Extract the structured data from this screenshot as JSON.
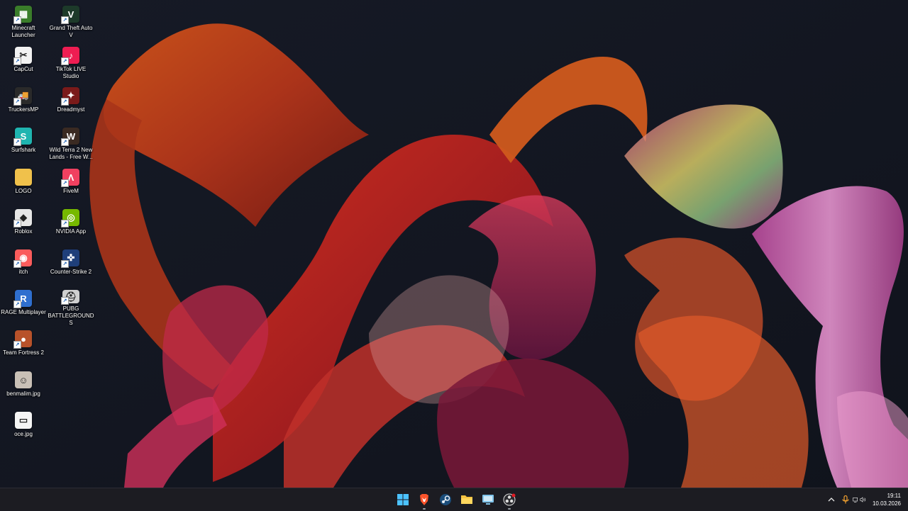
{
  "desktop": {
    "icons": [
      {
        "label": "Minecraft Launcher",
        "icon": "minecraft-icon",
        "color": "#3a7d2a",
        "glyph": "▦"
      },
      {
        "label": "CapCut",
        "icon": "capcut-icon",
        "color": "#f2f2f2",
        "glyph": "✂"
      },
      {
        "label": "TruckersMP",
        "icon": "truckersmp-icon",
        "color": "#2a2a2a",
        "glyph": "🚚"
      },
      {
        "label": "Surfshark",
        "icon": "surfshark-icon",
        "color": "#1fb5b0",
        "glyph": "S"
      },
      {
        "label": "LOGO",
        "icon": "folder-icon",
        "color": "#f0c14b",
        "glyph": ""
      },
      {
        "label": "Roblox",
        "icon": "roblox-icon",
        "color": "#e6e6e6",
        "glyph": "◆"
      },
      {
        "label": "itch",
        "icon": "itch-icon",
        "color": "#fa5c5c",
        "glyph": "◉"
      },
      {
        "label": "RAGE Multiplayer",
        "icon": "rage-icon",
        "color": "#2f6fcf",
        "glyph": "R"
      },
      {
        "label": "Team Fortress 2",
        "icon": "tf2-icon",
        "color": "#b8522a",
        "glyph": "●"
      },
      {
        "label": "benmalim.jpg",
        "icon": "image-file-icon",
        "color": "#c9c0b6",
        "glyph": "☺"
      },
      {
        "label": "oce.jpg",
        "icon": "image-file-icon",
        "color": "#f5f5f5",
        "glyph": "▭"
      },
      {
        "label": "Grand Theft Auto V",
        "icon": "gta-icon",
        "color": "#1d3a2a",
        "glyph": "V"
      },
      {
        "label": "TikTok LIVE Studio",
        "icon": "tiktok-live-icon",
        "color": "#ee1d52",
        "glyph": "♪"
      },
      {
        "label": "Dreadmyst",
        "icon": "dreadmyst-icon",
        "color": "#7a1a1a",
        "glyph": "✦"
      },
      {
        "label": "Wild Terra 2 New Lands - Free W...",
        "icon": "wildterra-icon",
        "color": "#3a2a22",
        "glyph": "W"
      },
      {
        "label": "FiveM",
        "icon": "fivem-icon",
        "color": "#f04060",
        "glyph": "Λ"
      },
      {
        "label": "NVIDIA App",
        "icon": "nvidia-icon",
        "color": "#76b900",
        "glyph": "◎"
      },
      {
        "label": "Counter-Strike 2",
        "icon": "cs2-icon",
        "color": "#1f3f7a",
        "glyph": "✜"
      },
      {
        "label": "PUBG BATTLEGROUNDS",
        "icon": "pubg-icon",
        "color": "#cfcfcf",
        "glyph": "⛑"
      }
    ]
  },
  "taskbar": {
    "apps": [
      {
        "name": "windows-start-icon",
        "running": false
      },
      {
        "name": "brave-browser-icon",
        "running": true
      },
      {
        "name": "steam-icon",
        "running": false
      },
      {
        "name": "file-explorer-icon",
        "running": false
      },
      {
        "name": "remote-desktop-icon",
        "running": false
      },
      {
        "name": "obs-icon",
        "running": true
      }
    ],
    "tray": {
      "time": "19:11",
      "date": "10.03.2026"
    }
  }
}
